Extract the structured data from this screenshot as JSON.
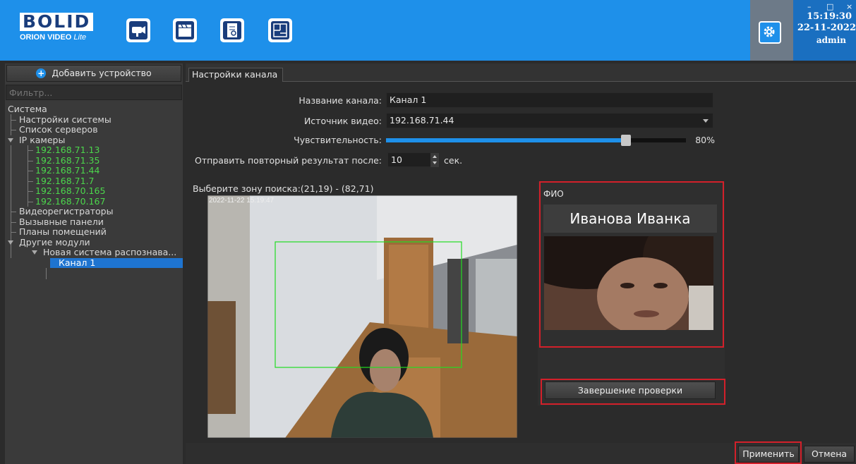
{
  "header": {
    "logo_top": "BOLID",
    "logo_bottom_1": "ORION VIDEO",
    "logo_bottom_2": "Lite",
    "toolbar_icons": [
      "camera-icon",
      "clapperboard-icon",
      "report-icon",
      "floorplan-icon"
    ],
    "settings_icon": "gear-icon",
    "window_controls": [
      "–",
      "□",
      "×"
    ],
    "time": "15:19:30",
    "date": "22-11-2022",
    "user": "admin",
    "accent_color": "#1e90ea"
  },
  "sidebar": {
    "add_device_label": "Добавить устройство",
    "filter_placeholder": "Фильтр...",
    "tree": {
      "system": "Система",
      "system_settings": "Настройки системы",
      "server_list": "Список серверов",
      "ip_cameras": "IP камеры",
      "cameras": [
        "192.168.71.13",
        "192.168.71.35",
        "192.168.71.44",
        "192.168.71.7",
        "192.168.70.165",
        "192.168.70.167"
      ],
      "video_recorders": "Видеорегистраторы",
      "call_panels": "Вызывные панели",
      "floor_plans": "Планы помещений",
      "other_modules": "Другие модули",
      "recognition_system": "Новая система распознава...",
      "channel": "Канал 1"
    }
  },
  "tabs": {
    "channel_settings": "Настройки канала"
  },
  "form": {
    "channel_name_label": "Название канала:",
    "channel_name_value": "Канал 1",
    "video_source_label": "Источник видео:",
    "video_source_value": "192.168.71.44",
    "sensitivity_label": "Чувствительность:",
    "sensitivity_value": 0.8,
    "sensitivity_text": "80%",
    "resend_label": "Отправить повторный результат после:",
    "resend_value": "10",
    "resend_unit": "сек."
  },
  "video": {
    "zone_label": "Выберите зону поиска:(21,19) - (82,71)",
    "timestamp": "2022-11-22 15:19:47"
  },
  "recognition": {
    "fio_label": "ФИО",
    "person_name": "Иванова Иванка",
    "finish_check_label": "Завершение проверки"
  },
  "footer": {
    "apply_label": "Применить",
    "cancel_label": "Отмена"
  }
}
